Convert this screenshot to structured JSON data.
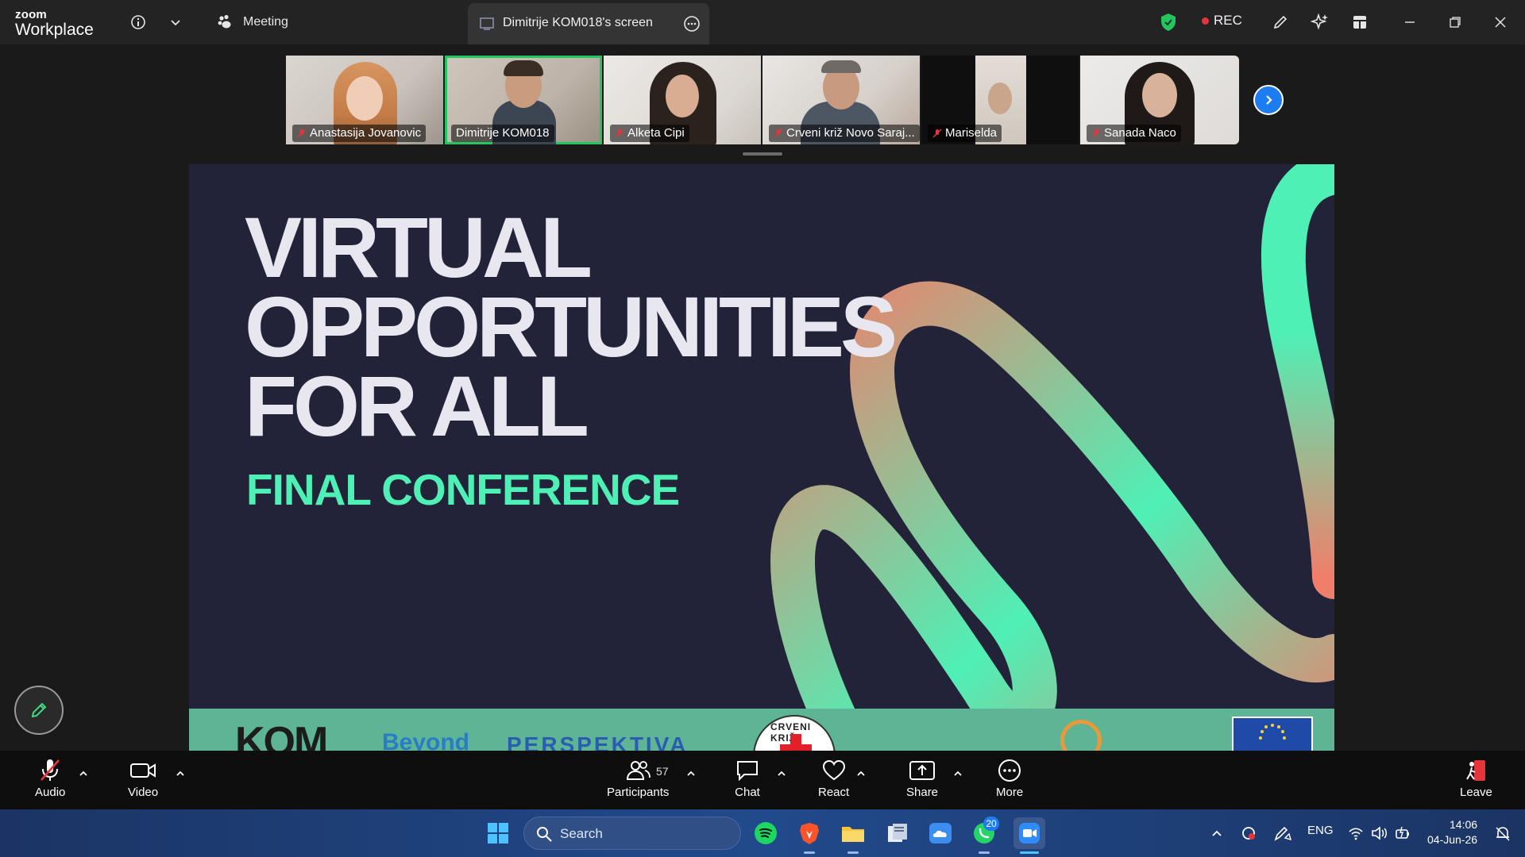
{
  "titlebar": {
    "brand_top": "zoom",
    "brand_bottom": "Workplace",
    "meeting_label": "Meeting",
    "screen_tab_label": "Dimitrije KOM018's screen",
    "rec_label": "REC"
  },
  "participants_strip": [
    {
      "name": "Anastasija Jovanovic",
      "muted": true
    },
    {
      "name": "Dimitrije KOM018",
      "muted": false,
      "active": true
    },
    {
      "name": "Alketa Cipi",
      "muted": true
    },
    {
      "name": "Crveni križ Novo Saraj...",
      "muted": true
    },
    {
      "name": "Mariselda",
      "muted": true
    },
    {
      "name": "Sanada Naco",
      "muted": true
    }
  ],
  "slide": {
    "title_line1": "VIRTUAL",
    "title_line2": "OPPORTUNITIES",
    "title_line3": "FOR ALL",
    "subtitle": "FINAL CONFERENCE",
    "logos": {
      "kom": "KOM",
      "beyond": "Beyond",
      "perspektiva": "PERSPEKTIVA",
      "red_cross": "CRVENI KRIŽ"
    },
    "colors": {
      "background": "#222239",
      "accent_green": "#4ff0b6",
      "accent_coral": "#f07f6a",
      "partner_band": "#5db596"
    }
  },
  "toolbar": {
    "audio": "Audio",
    "video": "Video",
    "participants": "Participants",
    "participant_count": "57",
    "chat": "Chat",
    "react": "React",
    "share": "Share",
    "more": "More",
    "leave": "Leave"
  },
  "taskbar": {
    "search_label": "Search",
    "whatsapp_badge": "20",
    "language": "ENG",
    "time": "14:06",
    "date": "04-Jun-26"
  }
}
